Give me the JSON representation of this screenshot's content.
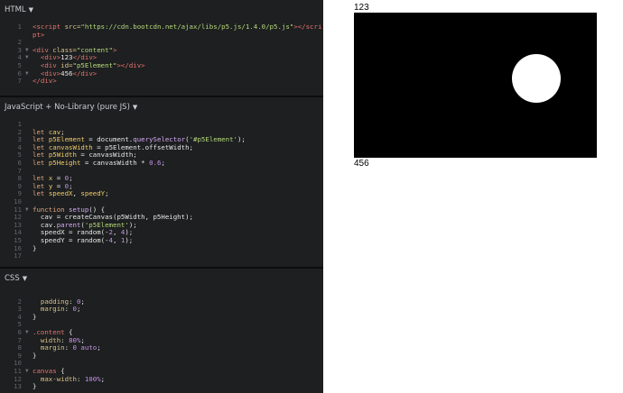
{
  "panels": {
    "html": {
      "title": "HTML"
    },
    "js": {
      "title": "JavaScript + No-Library (pure JS)"
    },
    "css": {
      "title": "CSS"
    }
  },
  "html_code": [
    {
      "n": "1",
      "fold": "",
      "parts": [
        [
          "t",
          "<script "
        ],
        [
          "a",
          "src="
        ],
        [
          "s",
          "\"https://cdn.bootcdn.net/ajax/libs/p5.js/1.4.0/p5.js\""
        ],
        [
          "t",
          "></scri"
        ]
      ]
    },
    {
      "n": "",
      "fold": "",
      "parts": [
        [
          "t",
          "pt>"
        ]
      ]
    },
    {
      "n": "2",
      "fold": "",
      "parts": []
    },
    {
      "n": "3",
      "fold": "▼",
      "parts": [
        [
          "t",
          "<div "
        ],
        [
          "a",
          "class="
        ],
        [
          "s",
          "\"content\""
        ],
        [
          "t",
          ">"
        ]
      ]
    },
    {
      "n": "4",
      "fold": "▼",
      "parts": [
        [
          "p",
          "  "
        ],
        [
          "t",
          "<div>"
        ],
        [
          "p",
          "123"
        ],
        [
          "t",
          "</div>"
        ]
      ]
    },
    {
      "n": "5",
      "fold": "",
      "parts": [
        [
          "p",
          "  "
        ],
        [
          "t",
          "<div "
        ],
        [
          "a",
          "id="
        ],
        [
          "s",
          "\"p5Element\""
        ],
        [
          "t",
          "></div>"
        ]
      ]
    },
    {
      "n": "6",
      "fold": "▼",
      "parts": [
        [
          "p",
          "  "
        ],
        [
          "t",
          "<div>"
        ],
        [
          "p",
          "456"
        ],
        [
          "t",
          "</div>"
        ]
      ]
    },
    {
      "n": "7",
      "fold": "",
      "parts": [
        [
          "t",
          "</div>"
        ]
      ]
    }
  ],
  "js_code": [
    {
      "n": "1",
      "fold": "",
      "parts": []
    },
    {
      "n": "2",
      "fold": "",
      "parts": [
        [
          "k",
          "let "
        ],
        [
          "v",
          "cav"
        ],
        [
          "p",
          ";"
        ]
      ]
    },
    {
      "n": "3",
      "fold": "",
      "parts": [
        [
          "k",
          "let "
        ],
        [
          "v",
          "p5Element"
        ],
        [
          "p",
          " = document."
        ],
        [
          "f",
          "querySelector"
        ],
        [
          "p",
          "("
        ],
        [
          "s",
          "'#p5Element'"
        ],
        [
          "p",
          ");"
        ]
      ]
    },
    {
      "n": "4",
      "fold": "",
      "parts": [
        [
          "k",
          "let "
        ],
        [
          "v",
          "canvasWidth"
        ],
        [
          "p",
          " = p5Element.offsetWidth;"
        ]
      ]
    },
    {
      "n": "5",
      "fold": "",
      "parts": [
        [
          "k",
          "let "
        ],
        [
          "v",
          "p5Width"
        ],
        [
          "p",
          " = canvasWidth;"
        ]
      ]
    },
    {
      "n": "6",
      "fold": "",
      "parts": [
        [
          "k",
          "let "
        ],
        [
          "v",
          "p5Height"
        ],
        [
          "p",
          " = canvasWidth * "
        ],
        [
          "n",
          "0.6"
        ],
        [
          "p",
          ";"
        ]
      ]
    },
    {
      "n": "7",
      "fold": "",
      "parts": []
    },
    {
      "n": "8",
      "fold": "",
      "parts": [
        [
          "k",
          "let "
        ],
        [
          "v",
          "x"
        ],
        [
          "p",
          " = "
        ],
        [
          "n",
          "0"
        ],
        [
          "p",
          ";"
        ]
      ]
    },
    {
      "n": "9",
      "fold": "",
      "parts": [
        [
          "k",
          "let "
        ],
        [
          "v",
          "y"
        ],
        [
          "p",
          " = "
        ],
        [
          "n",
          "0"
        ],
        [
          "p",
          ";"
        ]
      ]
    },
    {
      "n": "9",
      "fold": "",
      "parts": [
        [
          "k",
          "let "
        ],
        [
          "v",
          "speedX"
        ],
        [
          "p",
          ", "
        ],
        [
          "v",
          "speedY"
        ],
        [
          "p",
          ";"
        ]
      ]
    },
    {
      "n": "10",
      "fold": "",
      "parts": []
    },
    {
      "n": "11",
      "fold": "▼",
      "parts": [
        [
          "k",
          "function "
        ],
        [
          "f",
          "setup"
        ],
        [
          "p",
          "() {"
        ]
      ]
    },
    {
      "n": "12",
      "fold": "",
      "parts": [
        [
          "p",
          "  cav = createCanvas(p5Width, p5Height);"
        ]
      ]
    },
    {
      "n": "13",
      "fold": "",
      "parts": [
        [
          "p",
          "  cav."
        ],
        [
          "f",
          "parent"
        ],
        [
          "p",
          "("
        ],
        [
          "s",
          "'p5Element'"
        ],
        [
          "p",
          ");"
        ]
      ]
    },
    {
      "n": "14",
      "fold": "",
      "parts": [
        [
          "p",
          "  speedX = random(-"
        ],
        [
          "n",
          "2"
        ],
        [
          "p",
          ", "
        ],
        [
          "n",
          "4"
        ],
        [
          "p",
          ");"
        ]
      ]
    },
    {
      "n": "15",
      "fold": "",
      "parts": [
        [
          "p",
          "  speedY = random(-"
        ],
        [
          "n",
          "4"
        ],
        [
          "p",
          ", "
        ],
        [
          "n",
          "1"
        ],
        [
          "p",
          ");"
        ]
      ]
    },
    {
      "n": "16",
      "fold": "",
      "parts": [
        [
          "p",
          "}"
        ]
      ]
    },
    {
      "n": "17",
      "fold": "",
      "parts": []
    }
  ],
  "css_code": [
    {
      "n": "",
      "fold": "",
      "parts": []
    },
    {
      "n": "2",
      "fold": "",
      "parts": [
        [
          "p",
          "  "
        ],
        [
          "a",
          "padding"
        ],
        [
          "p",
          ": "
        ],
        [
          "n",
          "0"
        ],
        [
          "p",
          ";"
        ]
      ]
    },
    {
      "n": "3",
      "fold": "",
      "parts": [
        [
          "p",
          "  "
        ],
        [
          "a",
          "margin"
        ],
        [
          "p",
          ": "
        ],
        [
          "n",
          "0"
        ],
        [
          "p",
          ";"
        ]
      ]
    },
    {
      "n": "4",
      "fold": "",
      "parts": [
        [
          "p",
          "}"
        ]
      ]
    },
    {
      "n": "5",
      "fold": "",
      "parts": []
    },
    {
      "n": "6",
      "fold": "▼",
      "parts": [
        [
          "t",
          ".content"
        ],
        [
          "p",
          " {"
        ]
      ]
    },
    {
      "n": "7",
      "fold": "",
      "parts": [
        [
          "p",
          "  "
        ],
        [
          "a",
          "width"
        ],
        [
          "p",
          ": "
        ],
        [
          "n",
          "80%"
        ],
        [
          "p",
          ";"
        ]
      ]
    },
    {
      "n": "8",
      "fold": "",
      "parts": [
        [
          "p",
          "  "
        ],
        [
          "a",
          "margin"
        ],
        [
          "p",
          ": "
        ],
        [
          "n",
          "0"
        ],
        [
          "p",
          " "
        ],
        [
          "n",
          "auto"
        ],
        [
          "p",
          ";"
        ]
      ]
    },
    {
      "n": "9",
      "fold": "",
      "parts": [
        [
          "p",
          "}"
        ]
      ]
    },
    {
      "n": "10",
      "fold": "",
      "parts": []
    },
    {
      "n": "11",
      "fold": "▼",
      "parts": [
        [
          "t",
          "canvas"
        ],
        [
          "p",
          " {"
        ]
      ]
    },
    {
      "n": "12",
      "fold": "",
      "parts": [
        [
          "p",
          "  "
        ],
        [
          "a",
          "max-width"
        ],
        [
          "p",
          ": "
        ],
        [
          "n",
          "100%"
        ],
        [
          "p",
          ";"
        ]
      ]
    },
    {
      "n": "13",
      "fold": "",
      "parts": [
        [
          "p",
          "}"
        ]
      ]
    }
  ],
  "preview": {
    "top_text": "123",
    "bottom_text": "456",
    "canvas_color": "#000000",
    "ball_color": "#ffffff"
  }
}
